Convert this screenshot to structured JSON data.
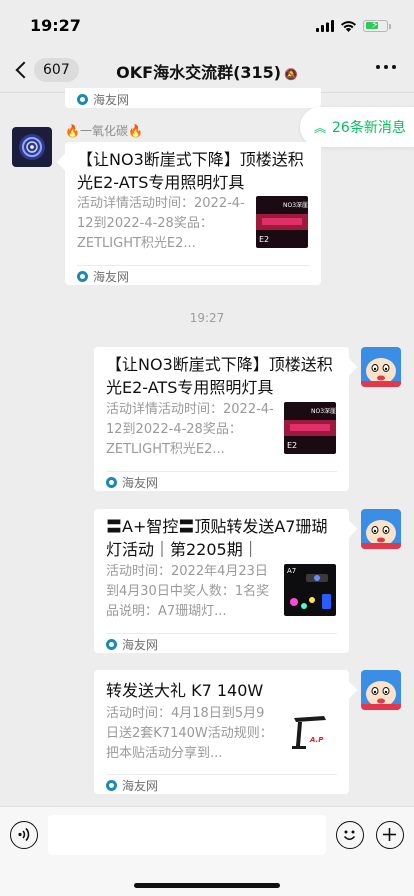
{
  "status": {
    "time": "19:27"
  },
  "nav": {
    "back_count": "607",
    "title": "OKF海水交流群(315)"
  },
  "new_messages": {
    "label": "26条新消息"
  },
  "timestamp": "19:27",
  "messages": [
    {
      "sender": "🔥一氧化碳🔥",
      "side": "left",
      "title": "【让NO3断崖式下降】顶楼送积光E2-ATS专用照明灯具",
      "desc": "活动详情活动时间：2022-4-12到2022-4-28奖品：ZETLIGHT积光E2...",
      "source": "海友网"
    },
    {
      "side": "right",
      "title": "【让NO3断崖式下降】顶楼送积光E2-ATS专用照明灯具",
      "desc": "活动详情活动时间：2022-4-12到2022-4-28奖品：ZETLIGHT积光E2...",
      "source": "海友网"
    },
    {
      "side": "right",
      "title": "〓A+智控〓顶贴转发送A7珊瑚灯活动｜第2205期｜",
      "desc": "活动时间：2022年4月23日到4月30日中奖人数：1名奖品说明：A7珊瑚灯...",
      "source": "海友网"
    },
    {
      "side": "right",
      "title": "转发送大礼 K7 140W",
      "desc": "活动时间：4月18日到5月9日送2套K7140W活动规则：把本贴活动分享到...",
      "source": "海友网"
    }
  ],
  "top_partial_source": "海友网",
  "thumbs": {
    "e2_big": "NO3深崖 50本赠画",
    "e2_small": "E2",
    "a7": "A7",
    "k7": "A.P"
  },
  "colors": {
    "chat_bg": "#ededed",
    "accent_green": "#07c160",
    "card_bg": "#ffffff"
  }
}
